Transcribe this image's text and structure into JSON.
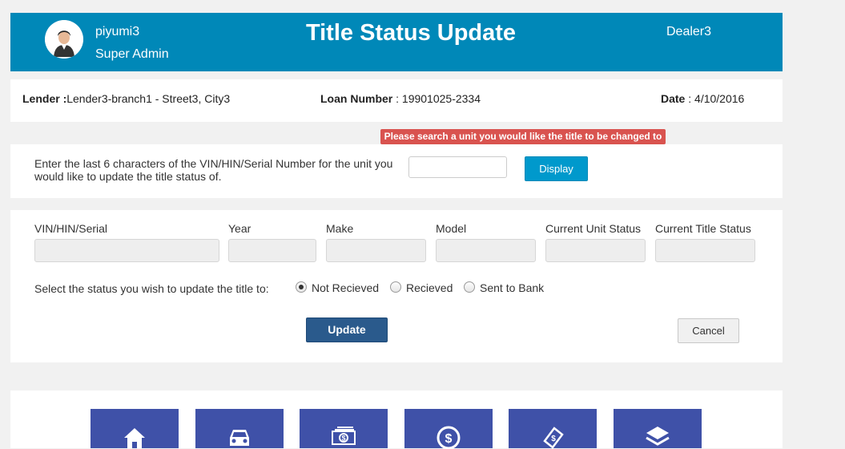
{
  "header": {
    "user_name": "piyumi3",
    "user_role": "Super Admin",
    "title": "Title Status Update",
    "dealer": "Dealer3"
  },
  "info": {
    "lender_label": "Lender :",
    "lender_value": "Lender3-branch1 - Street3, City3",
    "loan_label": "Loan Number",
    "loan_value": " : 19901025-2334",
    "date_label": "Date",
    "date_value": " : 4/10/2016"
  },
  "alert": "Please search a unit you would like the title to be changed to",
  "search": {
    "instruction": "Enter the last 6 characters of the VIN/HIN/Serial Number for the unit you would like to update the title status of.",
    "input_value": "",
    "display_label": "Display"
  },
  "details": {
    "columns": [
      "VIN/HIN/Serial",
      "Year",
      "Make",
      "Model",
      "Current Unit Status",
      "Current Title Status"
    ],
    "status_prompt": "Select the status you wish to update the title to:",
    "options": [
      "Not Recieved",
      "Recieved",
      "Sent to Bank"
    ],
    "selected_option": "Not Recieved",
    "update_label": "Update",
    "cancel_label": "Cancel"
  },
  "nav": {
    "icons": [
      "home-icon",
      "car-icon",
      "money-icon",
      "dollar-circle-icon",
      "payment-icon",
      "layers-icon"
    ]
  },
  "colors": {
    "header_bg": "#0088b8",
    "alert_bg": "#d9534f",
    "display_btn": "#0099cc",
    "update_btn": "#2a5a8c",
    "nav_tile": "#3f51a8"
  }
}
